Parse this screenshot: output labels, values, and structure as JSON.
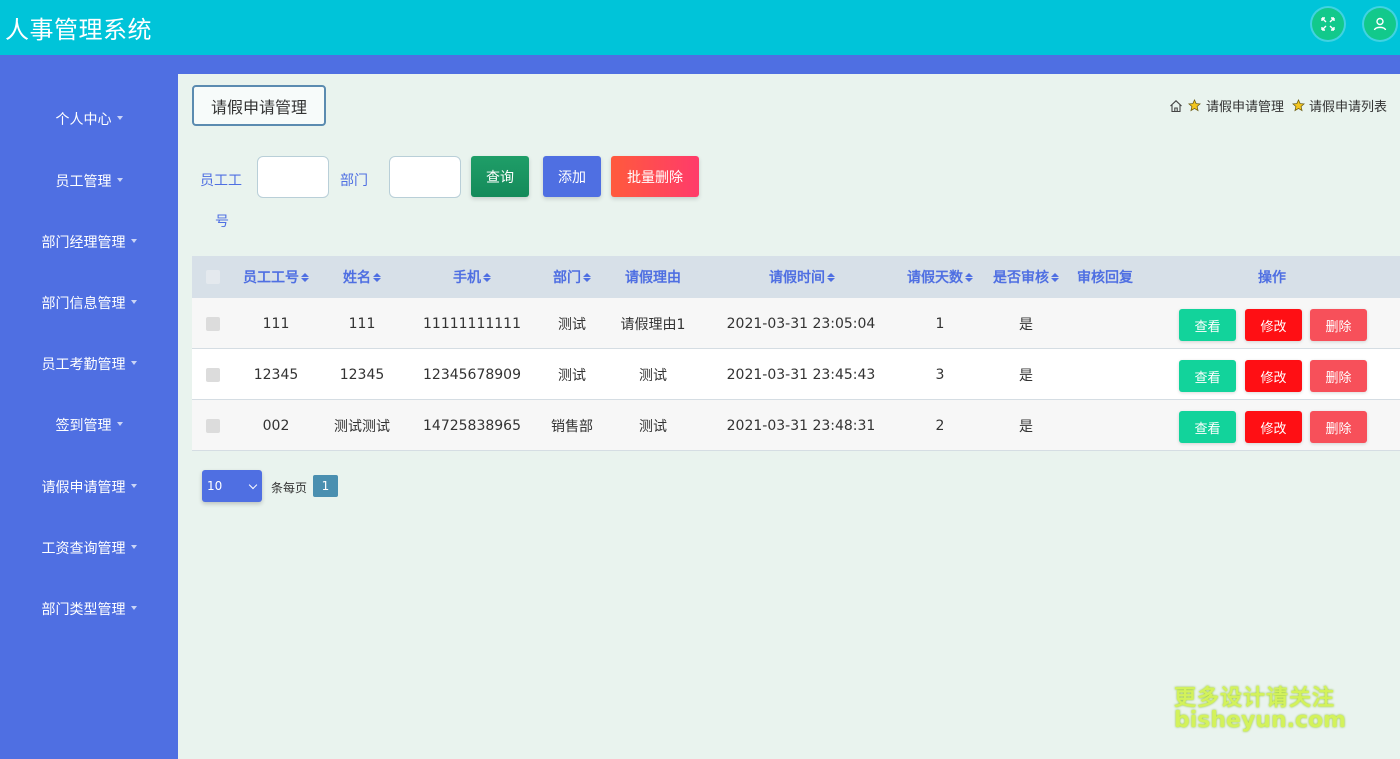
{
  "header": {
    "title": "人事管理系统",
    "icons": [
      "fullscreen-icon",
      "user-icon"
    ]
  },
  "sidebar": {
    "items": [
      {
        "label": "个人中心"
      },
      {
        "label": "员工管理"
      },
      {
        "label": "部门经理管理"
      },
      {
        "label": "部门信息管理"
      },
      {
        "label": "员工考勤管理"
      },
      {
        "label": "签到管理"
      },
      {
        "label": "请假申请管理"
      },
      {
        "label": "工资查询管理"
      },
      {
        "label": "部门类型管理"
      }
    ]
  },
  "main": {
    "page_title": "请假申请管理",
    "breadcrumb": [
      "请假申请管理",
      "请假申请列表"
    ]
  },
  "search": {
    "employee_no_label_1": "员工工",
    "employee_no_label_2": "号",
    "employee_no_value": "",
    "department_label": "部门",
    "department_value": "",
    "query_button": "查询",
    "add_button": "添加",
    "bulk_delete_button": "批量删除"
  },
  "table": {
    "columns": [
      "员工工号",
      "姓名",
      "手机",
      "部门",
      "请假理由",
      "请假时间",
      "请假天数",
      "是否审核",
      "审核回复",
      "操作"
    ],
    "rows": [
      {
        "employee_no": "111",
        "name": "111",
        "phone": "11111111111",
        "department": "测试",
        "reason": "请假理由1",
        "time": "2021-03-31 23:05:04",
        "days": "1",
        "approved": "是",
        "reply": ""
      },
      {
        "employee_no": "12345",
        "name": "12345",
        "phone": "12345678909",
        "department": "测试",
        "reason": "测试",
        "time": "2021-03-31 23:45:43",
        "days": "3",
        "approved": "是",
        "reply": ""
      },
      {
        "employee_no": "002",
        "name": "测试测试",
        "phone": "14725838965",
        "department": "销售部",
        "reason": "测试",
        "time": "2021-03-31 23:48:31",
        "days": "2",
        "approved": "是",
        "reply": ""
      }
    ],
    "actions": {
      "view": "查看",
      "edit": "修改",
      "delete": "删除"
    }
  },
  "pagination": {
    "page_size": "10",
    "per_page_label": "条每页",
    "current_page": "1"
  },
  "watermark": {
    "line1": "更多设计请关注",
    "line2": "bisheyun.com"
  },
  "colors": {
    "topbar": "#00c4d9",
    "sidebar": "#4f6fe2",
    "accent": "#4f6fe2",
    "view": "#12d39b",
    "edit": "#ff0f14",
    "delete": "#f7505a"
  }
}
